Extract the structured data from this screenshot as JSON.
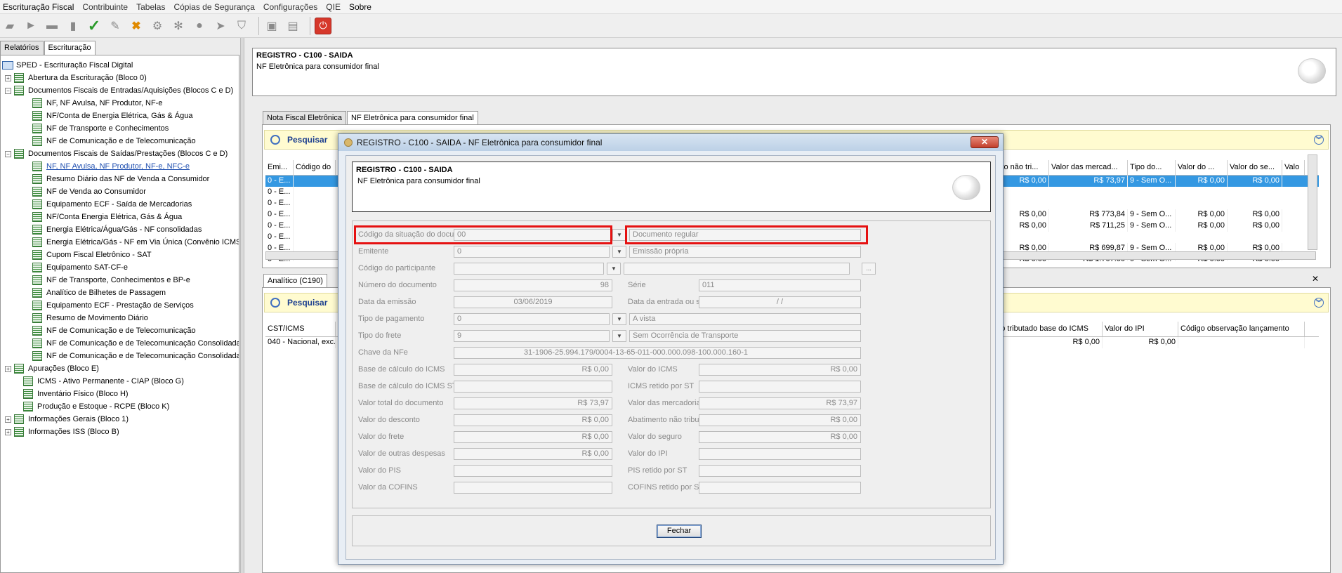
{
  "menu": {
    "items": [
      {
        "label": "Escrituração Fiscal"
      },
      {
        "label": "Contribuinte"
      },
      {
        "label": "Tabelas"
      },
      {
        "label": "Cópias de Segurança"
      },
      {
        "label": "Configurações"
      },
      {
        "label": "QIE"
      },
      {
        "label": "Sobre"
      }
    ]
  },
  "left_tabs": [
    "Relatórios",
    "Escrituração"
  ],
  "tree": {
    "root": "SPED - Escrituração Fiscal Digital",
    "nodes": [
      "Abertura da Escrituração (Bloco 0)",
      "Documentos Fiscais de Entradas/Aquisições (Blocos C e D)",
      "NF, NF Avulsa, NF Produtor, NF-e",
      "NF/Conta de Energia Elétrica, Gás & Água",
      "NF de Transporte e Conhecimentos",
      "NF de Comunicação e de Telecomunicação",
      "Documentos Fiscais de Saídas/Prestações (Blocos C e D)",
      "NF, NF Avulsa, NF Produtor, NF-e, NFC-e",
      "Resumo Diário das NF de Venda a Consumidor",
      "NF de Venda ao Consumidor",
      "Equipamento ECF - Saída de Mercadorias",
      "NF/Conta Energia Elétrica, Gás & Água",
      "Energia Elétrica/Água/Gás - NF consolidadas",
      "Energia Elétrica/Gás - NF em Via Única (Convênio ICMS",
      "Cupom Fiscal Eletrônico - SAT",
      "Equipamento SAT-CF-e",
      "NF de Transporte, Conhecimentos e BP-e",
      "Analítico de Bilhetes de Passagem",
      "Equipamento ECF - Prestação de Serviços",
      "Resumo de Movimento Diário",
      "NF de Comunicação e de Telecomunicação",
      "NF de Comunicação e de Telecomunicação Consolidada",
      "NF de Comunicação e de Telecomunicação Consolidada",
      "Apurações (Bloco E)",
      "ICMS - Ativo Permanente - CIAP (Bloco G)",
      "Inventário Físico (Bloco H)",
      "Produção e Estoque - RCPE (Bloco K)",
      "Informações Gerais (Bloco 1)",
      "Informações ISS (Bloco B)"
    ]
  },
  "header": {
    "title": "REGISTRO - C100 - SAIDA",
    "subtitle": "NF Eletrônica para consumidor final"
  },
  "main_tabs": [
    "Nota Fiscal Eletrônica",
    "NF Eletrônica para consumidor final"
  ],
  "search_label": "Pesquisar",
  "grid1": {
    "headers_left": [
      "Emi...",
      "Código do"
    ],
    "headers_right": [
      "mento não tri...",
      "Valor das mercad...",
      "Tipo do...",
      "Valor do ...",
      "Valor do se...",
      "Valo"
    ],
    "rows": [
      {
        "emi": "0 - E...",
        "a": "R$ 0,00",
        "b": "R$ 73,97",
        "c": "9 - Sem O...",
        "d": "R$ 0,00",
        "e": "R$ 0,00"
      },
      {
        "emi": "0 - E...",
        "a": "",
        "b": "",
        "c": "",
        "d": "",
        "e": ""
      },
      {
        "emi": "0 - E...",
        "a": "",
        "b": "",
        "c": "",
        "d": "",
        "e": ""
      },
      {
        "emi": "0 - E...",
        "a": "R$ 0,00",
        "b": "R$ 773,84",
        "c": "9 - Sem O...",
        "d": "R$ 0,00",
        "e": "R$ 0,00"
      },
      {
        "emi": "0 - E...",
        "a": "R$ 0,00",
        "b": "R$ 711,25",
        "c": "9 - Sem O...",
        "d": "R$ 0,00",
        "e": "R$ 0,00"
      },
      {
        "emi": "0 - E...",
        "a": "",
        "b": "",
        "c": "",
        "d": "",
        "e": ""
      },
      {
        "emi": "0 - E...",
        "a": "R$ 0,00",
        "b": "R$ 699,87",
        "c": "9 - Sem O...",
        "d": "R$ 0,00",
        "e": "R$ 0,00"
      },
      {
        "emi": "0 - E...",
        "a": "R$ 0,00",
        "b": "R$ 1.707,00",
        "c": "9 - Sem O...",
        "d": "R$ 0,00",
        "e": "R$ 0,00"
      }
    ]
  },
  "anal_tab": "Analítico (C190)",
  "grid2": {
    "header_left": "CST/ICMS",
    "headers_right": [
      "não tributado base do ICMS",
      "Valor do IPI",
      "Código observação lançamento"
    ],
    "row": {
      "cst": "040 - Nacional, exc...",
      "a": "R$ 0,00",
      "b": "R$ 0,00",
      "c": ""
    }
  },
  "dialog": {
    "title": "REGISTRO - C100 - SAIDA - NF Eletrônica para consumidor final",
    "close_symbol": "✕",
    "header_title": "REGISTRO - C100 - SAIDA",
    "header_subtitle": "NF Eletrônica para consumidor final",
    "fields": {
      "cod_sit_label": "Código da situação do documento",
      "cod_sit_value": "00",
      "cod_sit_desc": "Documento regular",
      "emitente_label": "Emitente",
      "emitente_value": "0",
      "emitente_desc": "Emissão própria",
      "participante_label": "Código do participante",
      "participante_value": "",
      "participante_desc": "",
      "participante_btn": "...",
      "numero_label": "Número do documento",
      "numero_value": "98",
      "serie_label": "Série",
      "serie_value": "011",
      "data_emissao_label": "Data da emissão",
      "data_emissao_value": "03/06/2019",
      "data_entrada_label": "Data da entrada ou saída",
      "data_entrada_value": "/  /",
      "tipo_pag_label": "Tipo de pagamento",
      "tipo_pag_value": "0",
      "tipo_pag_desc": "A vista",
      "tipo_frete_label": "Tipo do frete",
      "tipo_frete_value": "9",
      "tipo_frete_desc": "Sem Ocorrência de Transporte",
      "chave_label": "Chave da NFe",
      "chave_value": "31-1906-25.994.179/0004-13-65-011-000.000.098-100.000.160-1",
      "bc_icms_label": "Base de cálculo do ICMS",
      "bc_icms_value": "R$ 0,00",
      "vl_icms_label": "Valor do ICMS",
      "vl_icms_value": "R$ 0,00",
      "bc_icms_st_label": "Base de cálculo do ICMS ST",
      "bc_icms_st_value": "",
      "icms_ret_st_label": "ICMS retido por ST",
      "icms_ret_st_value": "",
      "vl_total_label": "Valor total do documento",
      "vl_total_value": "R$ 73,97",
      "vl_merc_label": "Valor das mercadorias",
      "vl_merc_value": "R$ 73,97",
      "vl_desc_label": "Valor do desconto",
      "vl_desc_value": "R$ 0,00",
      "abat_label": "Abatimento não tributado",
      "abat_value": "R$ 0,00",
      "vl_frete_label": "Valor do frete",
      "vl_frete_value": "R$ 0,00",
      "vl_seg_label": "Valor do seguro",
      "vl_seg_value": "R$ 0,00",
      "vl_outras_label": "Valor de outras despesas",
      "vl_outras_value": "R$ 0,00",
      "vl_ipi_label": "Valor do IPI",
      "vl_ipi_value": "",
      "vl_pis_label": "Valor do PIS",
      "vl_pis_value": "",
      "pis_ret_label": "PIS retido por ST",
      "pis_ret_value": "",
      "vl_cofins_label": "Valor da COFINS",
      "vl_cofins_value": "",
      "cofins_ret_label": "COFINS retido por ST",
      "cofins_ret_value": ""
    },
    "button_close": "Fechar"
  },
  "colors": {
    "selection": "#3498e2",
    "highlight": "#e51111",
    "search_bg": "#fffbd0",
    "link": "#1f4fb0"
  }
}
